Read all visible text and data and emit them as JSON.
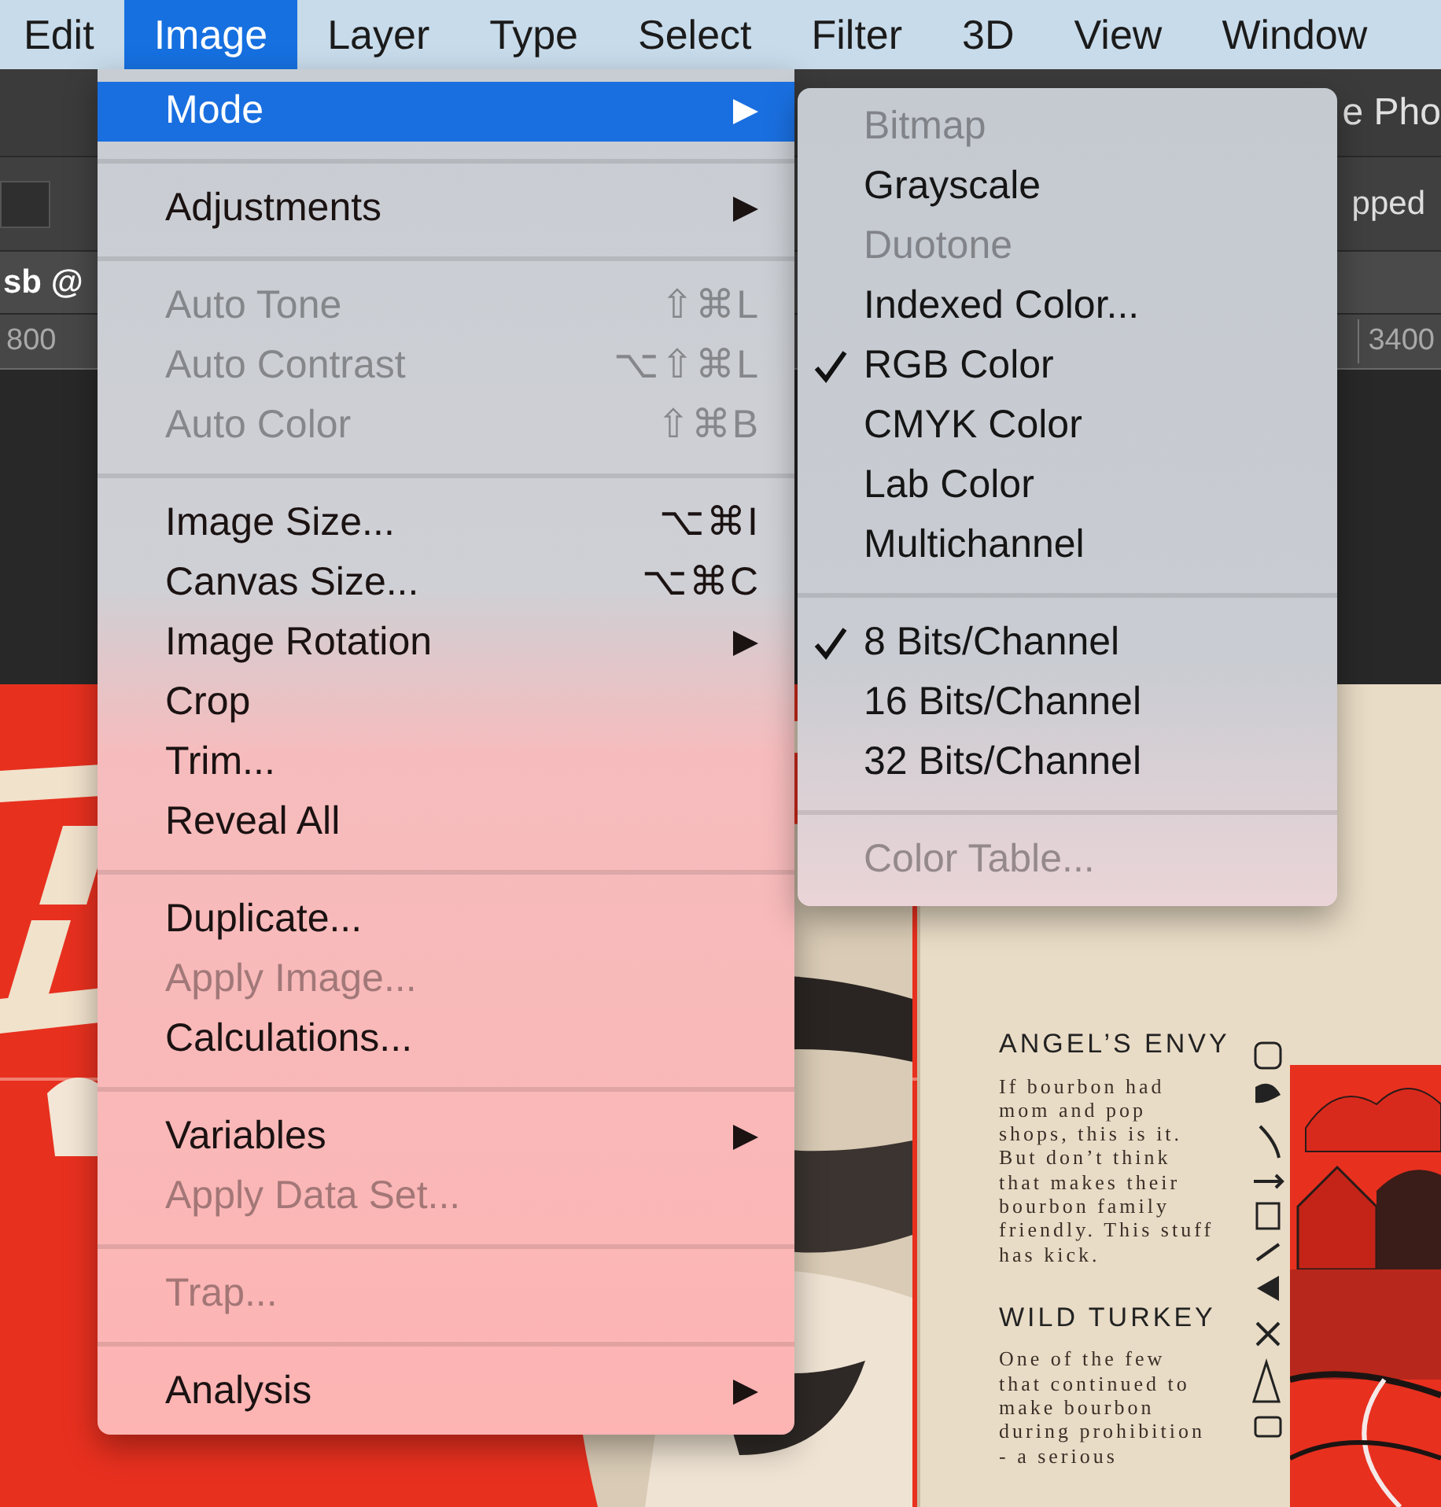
{
  "menu_bar": [
    {
      "label": "Edit",
      "selected": false
    },
    {
      "label": "Image",
      "selected": true
    },
    {
      "label": "Layer",
      "selected": false
    },
    {
      "label": "Type",
      "selected": false
    },
    {
      "label": "Select",
      "selected": false
    },
    {
      "label": "Filter",
      "selected": false
    },
    {
      "label": "3D",
      "selected": false
    },
    {
      "label": "View",
      "selected": false
    },
    {
      "label": "Window",
      "selected": false
    }
  ],
  "app": {
    "title_fragment": "e Pho",
    "options_fragment": "pped",
    "tab_fragment": "sb @",
    "ruler_labels": [
      "800",
      "3400"
    ]
  },
  "document": {
    "sections": [
      {
        "heading": "ANGEL’S ENVY",
        "body": "If bourbon had mom and pop shops, this is it. But don’t think that makes their bourbon family friendly. This stuff has kick."
      },
      {
        "heading": "WILD TURKEY",
        "body": "One of the few that continued to make bourbon during prohibition - a serious"
      }
    ]
  },
  "image_menu": {
    "items": [
      {
        "kind": "item",
        "label": "Mode",
        "submenu": true,
        "disabled": false,
        "selected": true
      },
      {
        "kind": "separator"
      },
      {
        "kind": "item",
        "label": "Adjustments",
        "submenu": true,
        "disabled": false,
        "selected": false
      },
      {
        "kind": "separator"
      },
      {
        "kind": "item",
        "label": "Auto Tone",
        "shortcut": "⇧⌘L",
        "submenu": false,
        "disabled": true,
        "selected": false
      },
      {
        "kind": "item",
        "label": "Auto Contrast",
        "shortcut": "⌥⇧⌘L",
        "submenu": false,
        "disabled": true,
        "selected": false
      },
      {
        "kind": "item",
        "label": "Auto Color",
        "shortcut": "⇧⌘B",
        "submenu": false,
        "disabled": true,
        "selected": false
      },
      {
        "kind": "separator"
      },
      {
        "kind": "item",
        "label": "Image Size...",
        "shortcut": "⌥⌘I",
        "submenu": false,
        "disabled": false,
        "selected": false
      },
      {
        "kind": "item",
        "label": "Canvas Size...",
        "shortcut": "⌥⌘C",
        "submenu": false,
        "disabled": false,
        "selected": false
      },
      {
        "kind": "item",
        "label": "Image Rotation",
        "submenu": true,
        "disabled": false,
        "selected": false
      },
      {
        "kind": "item",
        "label": "Crop",
        "submenu": false,
        "disabled": false,
        "selected": false
      },
      {
        "kind": "item",
        "label": "Trim...",
        "submenu": false,
        "disabled": false,
        "selected": false
      },
      {
        "kind": "item",
        "label": "Reveal All",
        "submenu": false,
        "disabled": false,
        "selected": false
      },
      {
        "kind": "separator"
      },
      {
        "kind": "item",
        "label": "Duplicate...",
        "submenu": false,
        "disabled": false,
        "selected": false
      },
      {
        "kind": "item",
        "label": "Apply Image...",
        "submenu": false,
        "disabled": true,
        "selected": false
      },
      {
        "kind": "item",
        "label": "Calculations...",
        "submenu": false,
        "disabled": false,
        "selected": false
      },
      {
        "kind": "separator"
      },
      {
        "kind": "item",
        "label": "Variables",
        "submenu": true,
        "disabled": false,
        "selected": false
      },
      {
        "kind": "item",
        "label": "Apply Data Set...",
        "submenu": false,
        "disabled": true,
        "selected": false
      },
      {
        "kind": "separator"
      },
      {
        "kind": "item",
        "label": "Trap...",
        "submenu": false,
        "disabled": true,
        "selected": false
      },
      {
        "kind": "separator"
      },
      {
        "kind": "item",
        "label": "Analysis",
        "submenu": true,
        "disabled": false,
        "selected": false
      }
    ]
  },
  "mode_submenu": {
    "items": [
      {
        "kind": "item",
        "label": "Bitmap",
        "checked": false,
        "disabled": true
      },
      {
        "kind": "item",
        "label": "Grayscale",
        "checked": false,
        "disabled": false
      },
      {
        "kind": "item",
        "label": "Duotone",
        "checked": false,
        "disabled": true
      },
      {
        "kind": "item",
        "label": "Indexed Color...",
        "checked": false,
        "disabled": false
      },
      {
        "kind": "item",
        "label": "RGB Color",
        "checked": true,
        "disabled": false
      },
      {
        "kind": "item",
        "label": "CMYK Color",
        "checked": false,
        "disabled": false
      },
      {
        "kind": "item",
        "label": "Lab Color",
        "checked": false,
        "disabled": false
      },
      {
        "kind": "item",
        "label": "Multichannel",
        "checked": false,
        "disabled": false
      },
      {
        "kind": "separator"
      },
      {
        "kind": "item",
        "label": "8 Bits/Channel",
        "checked": true,
        "disabled": false
      },
      {
        "kind": "item",
        "label": "16 Bits/Channel",
        "checked": false,
        "disabled": false
      },
      {
        "kind": "item",
        "label": "32 Bits/Channel",
        "checked": false,
        "disabled": false
      },
      {
        "kind": "separator"
      },
      {
        "kind": "item",
        "label": "Color Table...",
        "checked": false,
        "disabled": true
      }
    ]
  }
}
